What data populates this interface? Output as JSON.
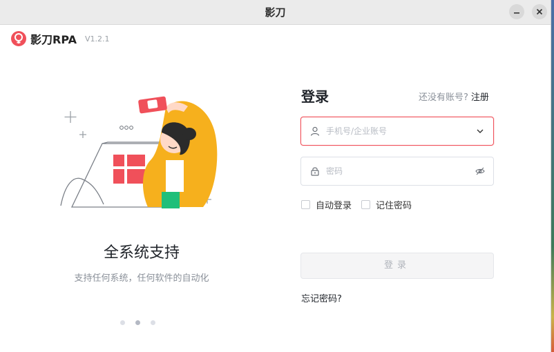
{
  "window": {
    "title": "影刀"
  },
  "app": {
    "name": "影刀RPA",
    "version": "V1.2.1",
    "brand_color": "#f0505a"
  },
  "carousel": {
    "title": "全系统支持",
    "subtitle": "支持任何系统，任何软件的自动化",
    "dots": 3,
    "active_index": 1
  },
  "login": {
    "heading": "登录",
    "no_account_text": "还没有账号?",
    "register_label": "注册",
    "username": {
      "placeholder": "手机号/企业账号",
      "value": "",
      "icon": "user-icon",
      "dropdown_icon": "chevron-down-icon"
    },
    "password": {
      "placeholder": "密码",
      "value": "",
      "icon": "lock-icon",
      "toggle_icon": "eye-off-icon"
    },
    "auto_login_label": "自动登录",
    "remember_label": "记住密码",
    "auto_login_checked": false,
    "remember_checked": false,
    "submit_label": "登录",
    "forgot_label": "忘记密码?"
  }
}
